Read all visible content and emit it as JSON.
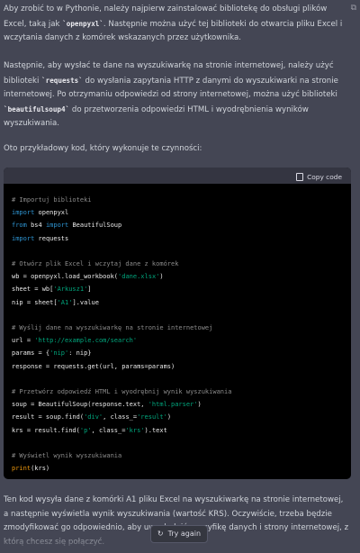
{
  "message": {
    "p1_before": "Aby zrobić to w Pythonie, należy najpierw zainstalować bibliotekę do obsługi plików Excel, taką jak ",
    "p1_code": "`openpyxl`",
    "p1_after": ". Następnie można użyć tej biblioteki do otwarcia pliku Excel i wczytania danych z komórek wskazanych przez użytkownika.",
    "p2_before": "Następnie, aby wysłać te dane na wyszukiwarkę na stronie internetowej, należy użyć biblioteki ",
    "p2_code1": "`requests`",
    "p2_mid": " do wysłania zapytania HTTP z danymi do wyszukiwarki na stronie internetowej. Po otrzymaniu odpowiedzi od strony internetowej, można użyć biblioteki ",
    "p2_code2": "`beautifulsoup4`",
    "p2_after": " do przetworzenia odpowiedzi HTML i wyodrębnienia wyników wyszukiwania.",
    "p3": "Oto przykładowy kod, który wykonuje te czynności:",
    "p4": "Ten kod wysyła dane z komórki A1 pliku Excel na wyszukiwarkę na stronie internetowej, a następnie wyświetla wynik wyszukiwania (wartość KRS). Oczywiście, trzeba będzie zmodyfikować go odpowiednio, aby uwzględnić specyfikę danych i strony internetowej, z którą chcesz się połączyć."
  },
  "code_block": {
    "copy_label": "Copy code",
    "lines": [
      {
        "t": "cm",
        "s": "# Importuj biblioteki"
      },
      {
        "t": "kw2",
        "a": "import",
        "b": " openpyxl"
      },
      {
        "t": "from",
        "a": "from",
        "b": " bs4 ",
        "c": "import",
        "d": " BeautifulSoup"
      },
      {
        "t": "kw2",
        "a": "import",
        "b": " requests"
      },
      {
        "t": "blank"
      },
      {
        "t": "cm",
        "s": "# Otwórz plik Excel i wczytaj dane z komórek"
      },
      {
        "t": "str",
        "a": "wb = openpyxl.load_workbook(",
        "s": "'dane.xlsx'",
        "b": ")"
      },
      {
        "t": "str",
        "a": "sheet = wb[",
        "s": "'Arkusz1'",
        "b": "]"
      },
      {
        "t": "str",
        "a": "nip = sheet[",
        "s": "'A1'",
        "b": "].value"
      },
      {
        "t": "blank"
      },
      {
        "t": "cm",
        "s": "# Wyślij dane na wyszukiwarkę na stronie internetowej"
      },
      {
        "t": "str",
        "a": "url = ",
        "s": "'http://example.com/search'",
        "b": ""
      },
      {
        "t": "str",
        "a": "params = {",
        "s": "'nip'",
        "b": ": nip}"
      },
      {
        "t": "plain",
        "s": "response = requests.get(url, params=params)"
      },
      {
        "t": "blank"
      },
      {
        "t": "cm",
        "s": "# Przetwórz odpowiedź HTML i wyodrębnij wynik wyszukiwania"
      },
      {
        "t": "str",
        "a": "soup = BeautifulSoup(response.text, ",
        "s": "'html.parser'",
        "b": ")"
      },
      {
        "t": "str2",
        "a": "result = soup.find(",
        "s": "'div'",
        "b": ", class_=",
        "s2": "'result'",
        "c": ")"
      },
      {
        "t": "str2",
        "a": "krs = result.find(",
        "s": "'p'",
        "b": ", class_=",
        "s2": "'krs'",
        "c": ").text"
      },
      {
        "t": "blank"
      },
      {
        "t": "cm",
        "s": "# Wyświetl wynik wyszukiwania"
      },
      {
        "t": "fn",
        "a": "print",
        "b": "(krs)"
      }
    ]
  },
  "try_again_label": "Try again",
  "icons": {
    "copy": "clipboard-icon",
    "side_copy": "copy-icon",
    "retry": "refresh-icon"
  }
}
